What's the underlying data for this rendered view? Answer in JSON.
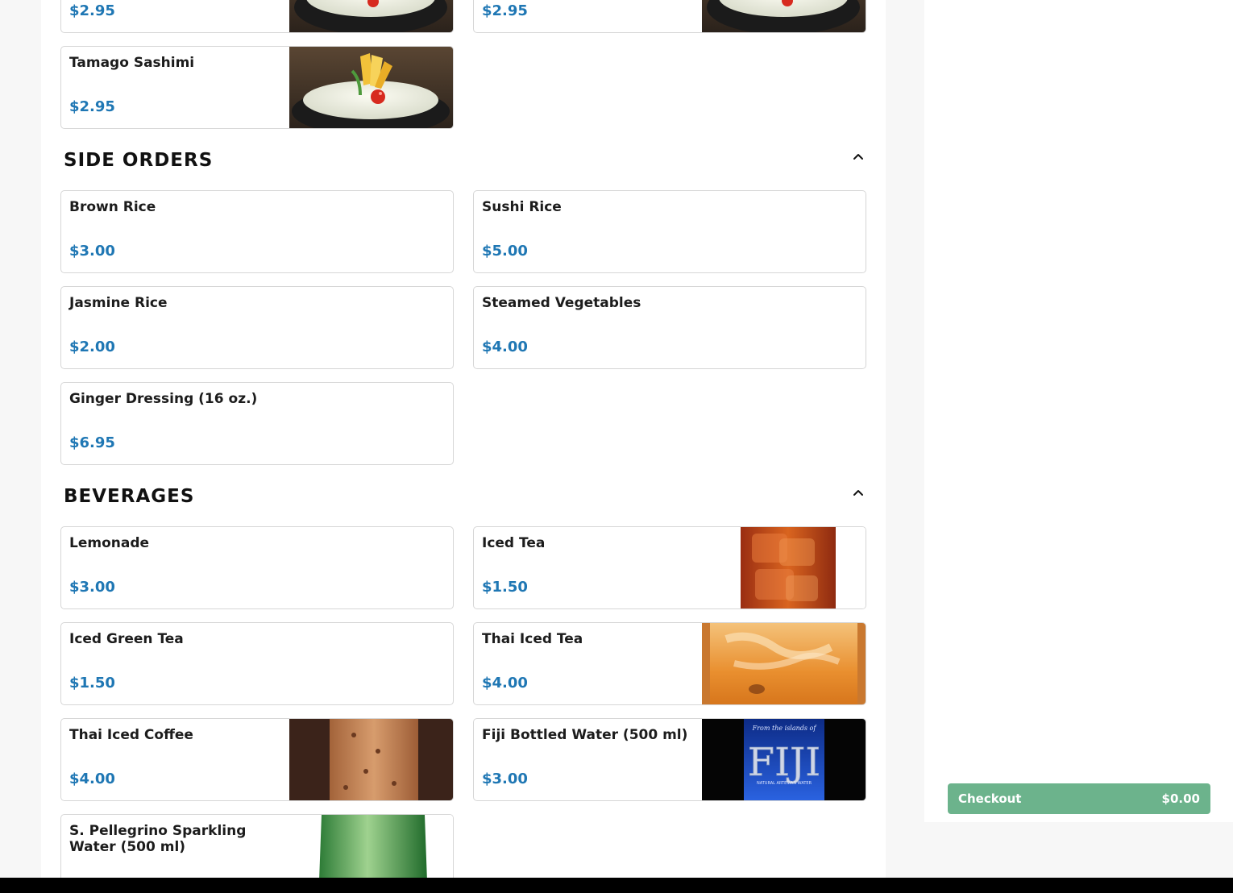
{
  "colors": {
    "price": "#1f77b4",
    "checkout_bg": "#6cb38c"
  },
  "top_partial": [
    {
      "price": "$2.95",
      "image": "sashimi-bowl-image"
    },
    {
      "price": "$2.95",
      "image": "sashimi-bowl-image"
    }
  ],
  "tamago": {
    "name": "Tamago Sashimi",
    "price": "$2.95",
    "image": "tamago-sashimi-image"
  },
  "side_orders": {
    "title": "SIDE ORDERS",
    "collapse_icon": "chevron-up-icon",
    "items": [
      {
        "name": "Brown Rice",
        "price": "$3.00"
      },
      {
        "name": "Sushi Rice",
        "price": "$5.00"
      },
      {
        "name": "Jasmine Rice",
        "price": "$2.00"
      },
      {
        "name": "Steamed Vegetables",
        "price": "$4.00"
      },
      {
        "name": "Ginger Dressing (16 oz.)",
        "price": "$6.95"
      }
    ]
  },
  "beverages": {
    "title": "BEVERAGES",
    "collapse_icon": "chevron-up-icon",
    "items": [
      {
        "name": "Lemonade",
        "price": "$3.00"
      },
      {
        "name": "Iced Tea",
        "price": "$1.50",
        "image": "iced-tea-image"
      },
      {
        "name": "Iced Green Tea",
        "price": "$1.50"
      },
      {
        "name": "Thai Iced Tea",
        "price": "$4.00",
        "image": "thai-iced-tea-image"
      },
      {
        "name": "Thai Iced Coffee",
        "price": "$4.00",
        "image": "thai-iced-coffee-image"
      },
      {
        "name": "Fiji Bottled Water (500 ml)",
        "price": "$3.00",
        "image": "fiji-water-image"
      },
      {
        "name": "S. Pellegrino Sparkling Water (500 ml)",
        "price": "",
        "image": "pellegrino-bottle-image"
      }
    ]
  },
  "checkout": {
    "label": "Checkout",
    "amount": "$0.00"
  },
  "fiji_logo": {
    "tagline": "From the islands of",
    "brand": "FIJI",
    "subtitle": "NATURAL ARTESIAN WATER"
  }
}
